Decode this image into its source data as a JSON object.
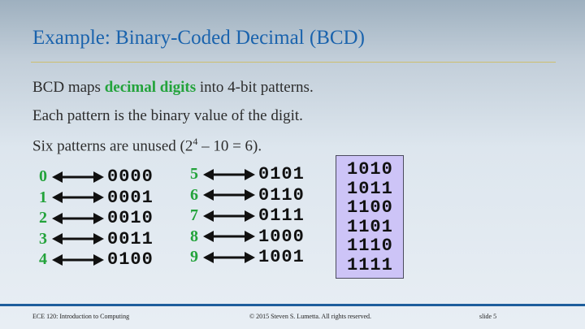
{
  "slide": {
    "title": "Example: Binary-Coded Decimal (BCD)",
    "line1": {
      "prefix": "BCD maps ",
      "highlight": "decimal digits",
      "suffix": " into 4-bit patterns."
    },
    "line2": "Each pattern is the binary value of the digit.",
    "line3": {
      "prefix": "Six patterns are unused (2",
      "exponent": "4",
      "suffix": " – 10 = 6)."
    },
    "mappings": [
      {
        "digit": "0",
        "code": "0000"
      },
      {
        "digit": "1",
        "code": "0001"
      },
      {
        "digit": "2",
        "code": "0010"
      },
      {
        "digit": "3",
        "code": "0011"
      },
      {
        "digit": "4",
        "code": "0100"
      },
      {
        "digit": "5",
        "code": "0101"
      },
      {
        "digit": "6",
        "code": "0110"
      },
      {
        "digit": "7",
        "code": "0111"
      },
      {
        "digit": "8",
        "code": "1000"
      },
      {
        "digit": "9",
        "code": "1001"
      }
    ],
    "unused_patterns": [
      "1010",
      "1011",
      "1100",
      "1101",
      "1110",
      "1111"
    ],
    "icons": {
      "mapping_arrow": "double-headed-arrow-icon"
    }
  },
  "footer": {
    "left": "ECE 120: Introduction to Computing",
    "center": "© 2015 Steven S. Lumetta.  All rights reserved.",
    "right": "slide 5"
  },
  "colors": {
    "title": "#1a63ad",
    "highlight": "#23a33b",
    "rule": "#cdbf6e",
    "footer_bar": "#1d5e9c",
    "unused_box": "#cdc4f7"
  }
}
